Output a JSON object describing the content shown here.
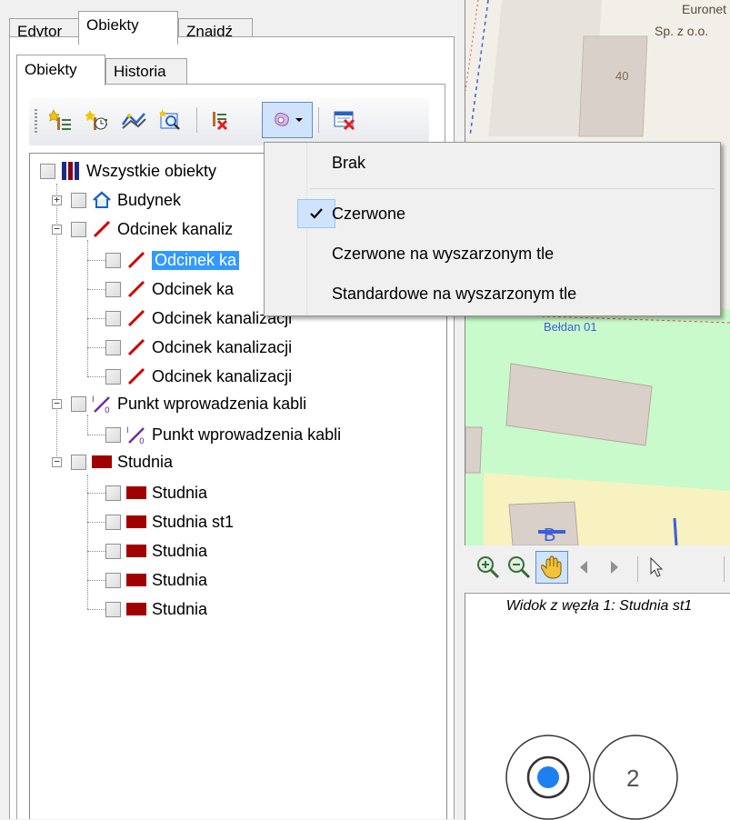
{
  "top_tabs": [
    "Edytor",
    "Obiekty",
    "Znajdź"
  ],
  "sub_tabs": [
    "Obiekty",
    "Historia"
  ],
  "tree": {
    "root": "Wszystkie obiekty",
    "budynek": "Budynek",
    "odcinek_group": "Odcinek kanaliz",
    "odcinek_children": [
      "Odcinek ka",
      "Odcinek ka",
      "Odcinek kanalizacji",
      "Odcinek kanalizacji",
      "Odcinek kanalizacji"
    ],
    "punkt_group": "Punkt wprowadzenia kabli",
    "punkt_child": "Punkt wprowadzenia kabli",
    "studnia_group": "Studnia",
    "studnia_children": [
      "Studnia",
      "Studnia st1",
      "Studnia",
      "Studnia",
      "Studnia"
    ]
  },
  "menu": {
    "items": [
      "Brak",
      "Czerwone",
      "Czerwone na wyszarzonym tle",
      "Standardowe na wyszarzonym tle"
    ],
    "checked": "Czerwone"
  },
  "map": {
    "label_company_1": "Euronet",
    "label_company_2": "Sp. z o.o.",
    "label_number": "40",
    "label_street": "Bełdan 01",
    "label_partial": "B"
  },
  "node_view": {
    "title": "Widok z węzła 1: Studnia st1",
    "node_label": "2"
  },
  "colors": {
    "selection": "#3399ff",
    "studnia": "#a00000",
    "odcinek": "#d00000",
    "punkt": "#6b2fa0",
    "map_green": "#c8facc"
  }
}
